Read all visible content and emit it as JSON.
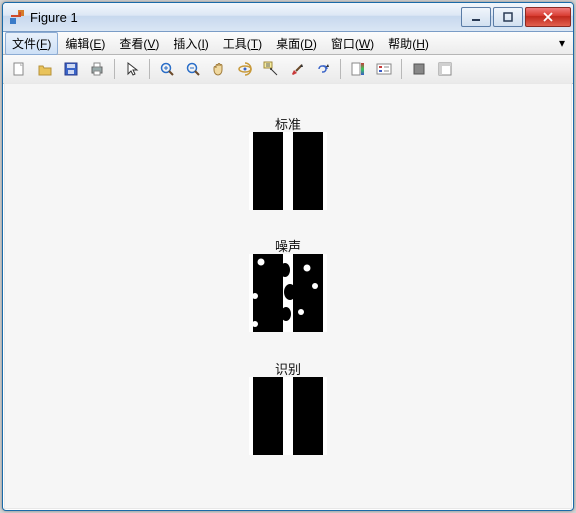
{
  "window": {
    "title": "Figure 1"
  },
  "menu": {
    "items": [
      {
        "label": "文件",
        "accel": "F"
      },
      {
        "label": "编辑",
        "accel": "E"
      },
      {
        "label": "查看",
        "accel": "V"
      },
      {
        "label": "插入",
        "accel": "I"
      },
      {
        "label": "工具",
        "accel": "T"
      },
      {
        "label": "桌面",
        "accel": "D"
      },
      {
        "label": "窗口",
        "accel": "W"
      },
      {
        "label": "帮助",
        "accel": "H"
      }
    ]
  },
  "toolbar": {
    "icons": {
      "new": "new-file-icon",
      "open": "open-folder-icon",
      "save": "save-icon",
      "print": "print-icon",
      "pointer": "pointer-icon",
      "zoomin": "zoom-in-icon",
      "zoomout": "zoom-out-icon",
      "pan": "pan-icon",
      "rotate": "rotate-3d-icon",
      "datacursor": "data-cursor-icon",
      "brush": "brush-icon",
      "link": "link-plots-icon",
      "colorbar": "colorbar-icon",
      "legend": "legend-icon",
      "hide": "hide-plot-tools-icon",
      "show": "show-plot-tools-icon"
    }
  },
  "plots": [
    {
      "title": "标准"
    },
    {
      "title": "噪声"
    },
    {
      "title": "识别"
    }
  ]
}
